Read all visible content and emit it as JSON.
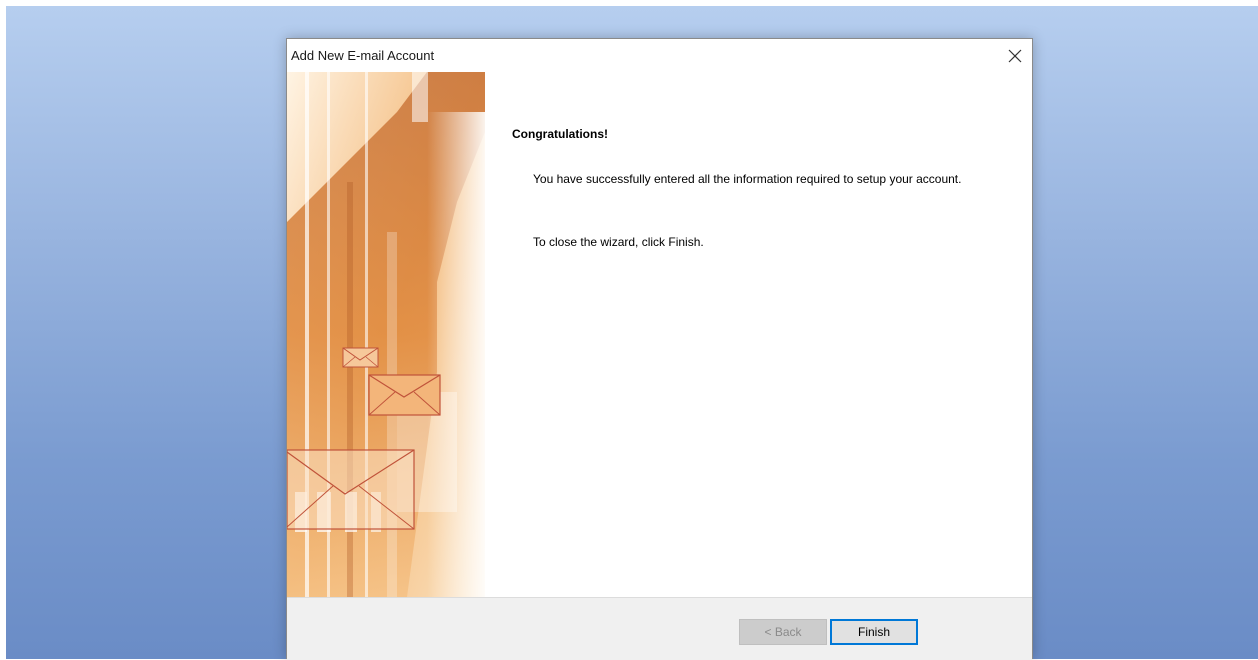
{
  "window": {
    "title": "Add New E-mail Account",
    "close_icon": "close-icon"
  },
  "content": {
    "heading": "Congratulations!",
    "message": "You have successfully entered all the information required to setup your account.",
    "instruction": "To close the wizard, click Finish."
  },
  "buttons": {
    "back_label": "< Back",
    "finish_label": "Finish"
  },
  "colors": {
    "accent": "#0078d7",
    "art_orange": "#e9a35a"
  }
}
